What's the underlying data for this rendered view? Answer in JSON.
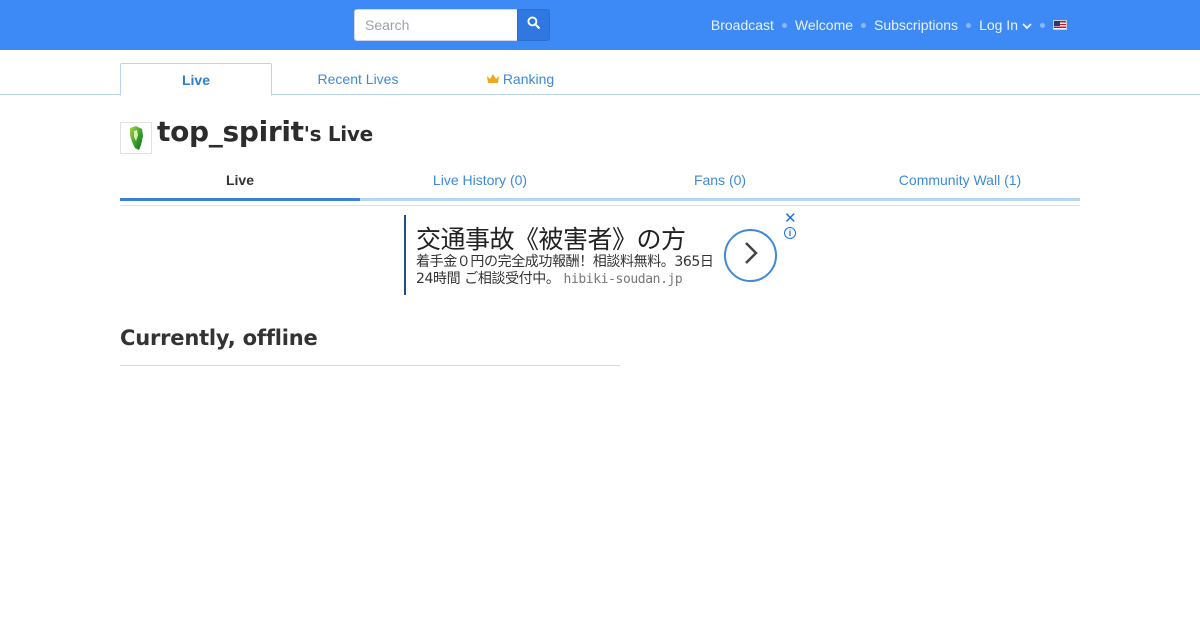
{
  "header": {
    "search_placeholder": "Search",
    "nav": {
      "broadcast": "Broadcast",
      "welcome": "Welcome",
      "subscriptions": "Subscriptions",
      "login": "Log In"
    },
    "icons": {
      "search": "search-icon",
      "login_dropdown": "chevron-down-icon",
      "language": "us-flag-icon"
    },
    "colors": {
      "bar": "#3d8af7"
    }
  },
  "main_tabs": [
    {
      "label": "Live",
      "active": true
    },
    {
      "label": "Recent Lives",
      "active": false
    },
    {
      "label": "Ranking",
      "active": false,
      "icon": "crown-icon"
    }
  ],
  "profile": {
    "username": "top_spirit",
    "suffix": "'s Live"
  },
  "sub_tabs": [
    {
      "label": "Live",
      "active": true
    },
    {
      "label": "Live History (0)",
      "active": false
    },
    {
      "label": "Fans (0)",
      "active": false
    },
    {
      "label": "Community Wall (1)",
      "active": false
    }
  ],
  "ad": {
    "title": "交通事故《被害者》の方",
    "description": "着手金０円の完全成功報酬！相談料無料。365日24時間 ご相談受付中。",
    "domain": "hibiki-soudan.jp",
    "close_symbol": "✕",
    "info_symbol": "i"
  },
  "status": {
    "heading": "Currently, offline"
  }
}
